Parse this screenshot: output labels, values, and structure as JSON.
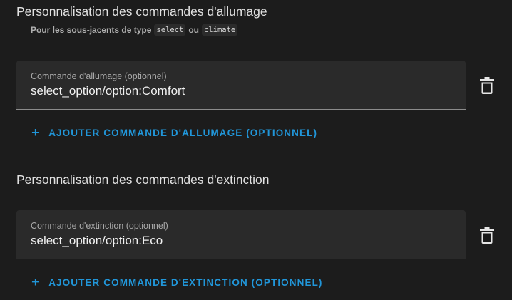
{
  "allumage": {
    "title": "Personnalisation des commandes d'allumage",
    "subtitle_prefix": "Pour les sous-jacents de type",
    "subtitle_code1": "select",
    "subtitle_conj": "ou",
    "subtitle_code2": "climate",
    "field_label": "Commande d'allumage (optionnel)",
    "field_value": "select_option/option:Comfort",
    "add_label": "AJOUTER COMMANDE D'ALLUMAGE (OPTIONNEL)"
  },
  "extinction": {
    "title": "Personnalisation des commandes d'extinction",
    "field_label": "Commande d'extinction (optionnel)",
    "field_value": "select_option/option:Eco",
    "add_label": "AJOUTER COMMANDE D'EXTINCTION (OPTIONNEL)"
  },
  "icons": {
    "delete": "trash-icon",
    "add": "plus-icon"
  },
  "colors": {
    "accent": "#2196d9",
    "background": "#1c1c1c",
    "field_background": "#2a2a2a"
  }
}
